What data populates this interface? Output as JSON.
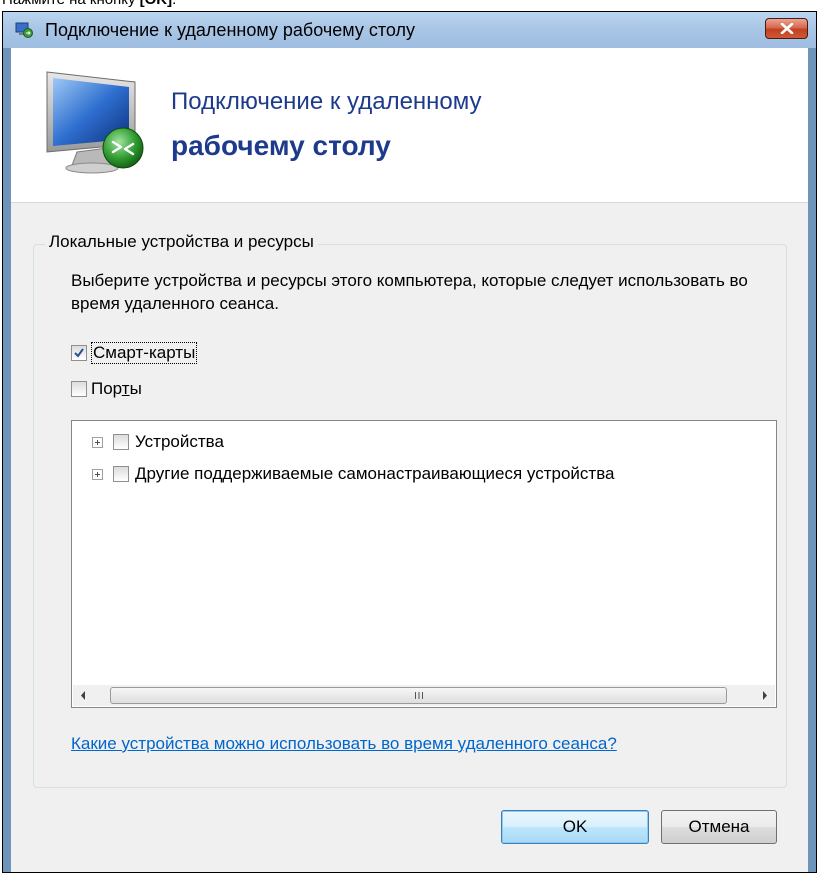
{
  "instruction": {
    "prefix": "Нажмите на кнопку ",
    "button": "[OK]",
    "suffix": "."
  },
  "window": {
    "title": "Подключение к удаленному рабочему столу",
    "icons": {
      "app": "remote-desktop-icon",
      "close": "close-icon"
    }
  },
  "header": {
    "line1": "Подключение к удаленному",
    "line2": "рабочему столу",
    "logo": "remote-desktop-monitor-icon"
  },
  "group": {
    "title": "Локальные устройства и ресурсы",
    "description": "Выберите устройства и ресурсы этого компьютера, которые следует использовать во время удаленного сеанса."
  },
  "checkboxes": [
    {
      "label": "Смарт-карты",
      "checked": true
    },
    {
      "label_before": "Пор",
      "label_underlined": "т",
      "label_after": "ы",
      "checked": false
    }
  ],
  "tree": {
    "items": [
      {
        "label": "Устройства",
        "checked": false,
        "expanded": false
      },
      {
        "label": "Другие поддерживаемые самонастраивающиеся устройства",
        "checked": false,
        "expanded": false
      }
    ],
    "scrollbar": {
      "grip_text": "III"
    }
  },
  "help_link": "Какие устройства можно использовать во время удаленного сеанса?",
  "buttons": {
    "ok": "OK",
    "cancel": "Отмена"
  },
  "colors": {
    "header_text": "#1e3a8c",
    "link": "#0066cc",
    "dialog_bg": "#f0f0f0"
  }
}
